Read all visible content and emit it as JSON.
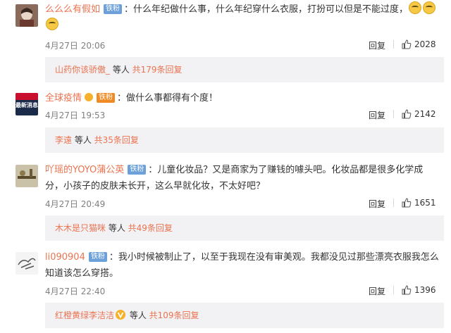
{
  "comments": [
    {
      "username": "么么么有假如",
      "badge": "铁粉",
      "colon": "：",
      "text": "什么年纪做什么事，什么年纪穿什么衣服，打扮可以但是不能过度，",
      "time": "4月27日 20:06",
      "reply_label": "回复",
      "likes": "2028",
      "replies": {
        "names": "山药你该骄傲_",
        "sep": " 等人 ",
        "count_text": "共179条回复"
      }
    },
    {
      "username": "全球疫情",
      "badge": "铁粉",
      "colon": "：",
      "text": "做什么事都得有个度！",
      "time": "4月27日 19:53",
      "reply_label": "回复",
      "likes": "2142",
      "avatar_text": "最新消息",
      "replies": {
        "names": "李遠",
        "sep": " 等人 ",
        "count_text": "共35条回复"
      }
    },
    {
      "username": "吖瑶的YOYO蒲公英",
      "badge": "铁粉",
      "colon": "：",
      "text": "儿童化妆品？又是商家为了赚钱的噱头吧。化妆品都是很多化学成分，小孩子的皮肤未长开，这么早就化妆，不太好吧？",
      "time": "4月27日 20:49",
      "reply_label": "回复",
      "likes": "1651",
      "replies": {
        "names": "木木是只猫咪",
        "sep": " 等人 ",
        "count_text": "共49条回复"
      }
    },
    {
      "username": "li090904",
      "badge": "铁粉",
      "colon": "：",
      "text": "我小时候被制止了，以至于我现在没有审美观。我都没见过那些漂亮衣服我怎么知道该怎么穿搭。",
      "time": "4月27日 22:40",
      "reply_label": "回复",
      "likes": "1396",
      "replies": {
        "names": "红橙黄绿李洁洁",
        "sep": " 等人 ",
        "count_text": "共109条回复"
      }
    }
  ],
  "icons": {
    "like": "thumbs-up-icon",
    "emoji": "laugh-cry-emoji-icon",
    "vip": "vip-icon",
    "verified": "v-verified-icon"
  },
  "colors": {
    "username": "#eb7350",
    "badge": "#6ca0d8",
    "replies_bg": "#f2f2f5"
  }
}
